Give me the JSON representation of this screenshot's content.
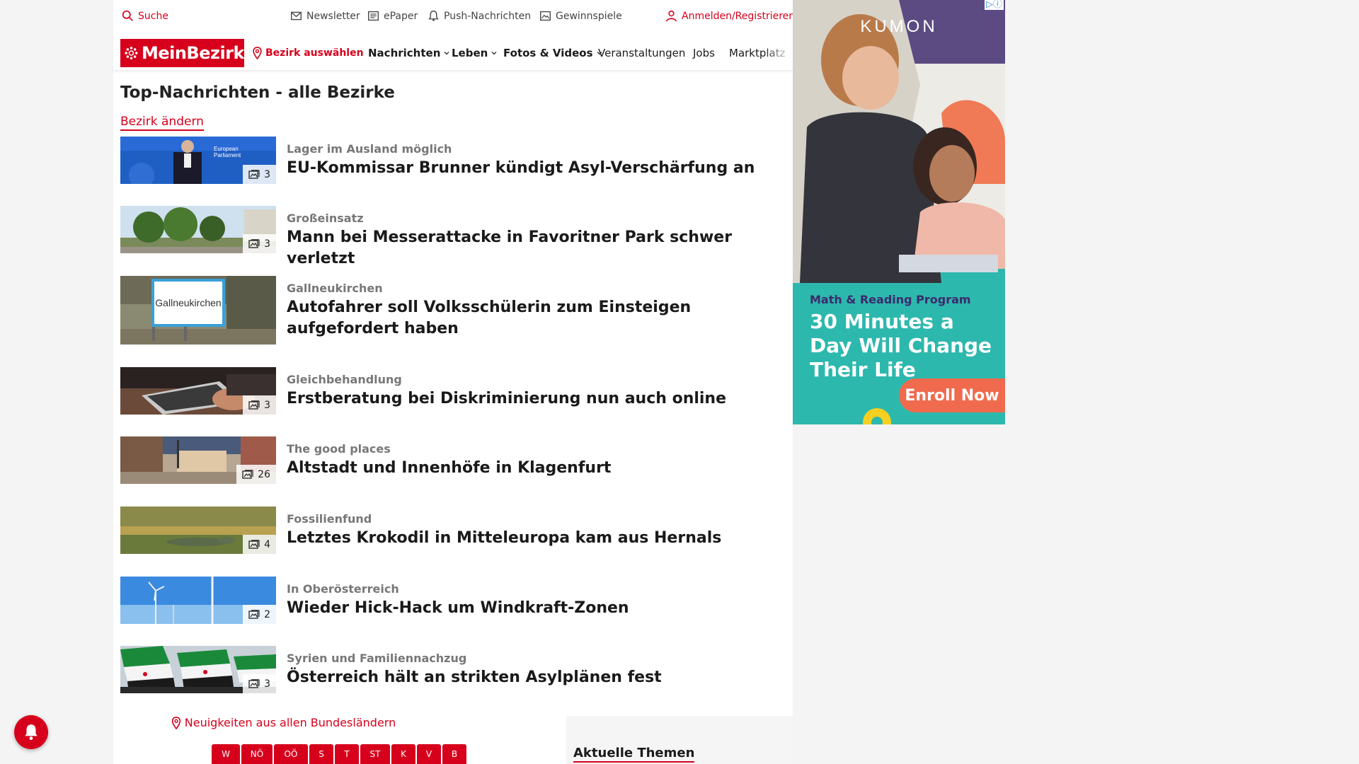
{
  "utility": {
    "search": "Suche",
    "newsletter": "Newsletter",
    "epaper": "ePaper",
    "push": "Push-Nachrichten",
    "games": "Gewinnspiele",
    "login": "Anmelden/Registrieren"
  },
  "nav": {
    "logo": "MeinBezirk",
    "district": "Bezirk auswählen",
    "items": [
      "Nachrichten",
      "Leben",
      "Fotos & Videos",
      "Veranstaltungen",
      "Jobs",
      "Marktplatz"
    ]
  },
  "page": {
    "title": "Top-Nachrichten - alle Bezirke",
    "change_district": "Bezirk ändern"
  },
  "articles": [
    {
      "kicker": "Lager im Ausland möglich",
      "headline": "EU-Kommissar Brunner kündigt Asyl-Verschärfung an",
      "images": "3"
    },
    {
      "kicker": "Großeinsatz",
      "headline": "Mann bei Messerattacke in Favoritner Park schwer verletzt",
      "images": "3"
    },
    {
      "kicker": "Gallneukirchen",
      "headline": "Autofahrer soll Volksschülerin zum Einsteigen aufgefordert haben",
      "images": "",
      "sign": "Gallneukirchen"
    },
    {
      "kicker": "Gleichbehandlung",
      "headline": "Erstberatung bei Diskriminierung nun auch online",
      "images": "3"
    },
    {
      "kicker": "The good places",
      "headline": "Altstadt und Innenhöfe in Klagenfurt",
      "images": "26"
    },
    {
      "kicker": "Fossilienfund",
      "headline": "Letztes Krokodil in Mitteleuropa kam aus Hernals",
      "images": "4"
    },
    {
      "kicker": "In Oberösterreich",
      "headline": "Wieder Hick-Hack um Windkraft-Zonen",
      "images": "2"
    },
    {
      "kicker": "Syrien und Familiennachzug",
      "headline": "Österreich hält an strikten Asylplänen fest",
      "images": "3"
    }
  ],
  "states": {
    "title": "Neuigkeiten aus allen Bundesländern",
    "items": [
      "W",
      "NÖ",
      "OÖ",
      "S",
      "T",
      "ST",
      "K",
      "V",
      "B"
    ]
  },
  "topics": {
    "title": "Aktuelle Themen"
  },
  "ad": {
    "brand": "KUMON",
    "subline": "Math & Reading Program",
    "headline": "30 Minutes a Day Will Change Their Life",
    "cta": "Enroll Now",
    "adchoice": "▷ⓘ"
  },
  "colors": {
    "brand_red": "#d6001c",
    "ad_teal": "#2db8ad",
    "ad_purple": "#3b2a6e",
    "ad_orange": "#f06a4e"
  }
}
